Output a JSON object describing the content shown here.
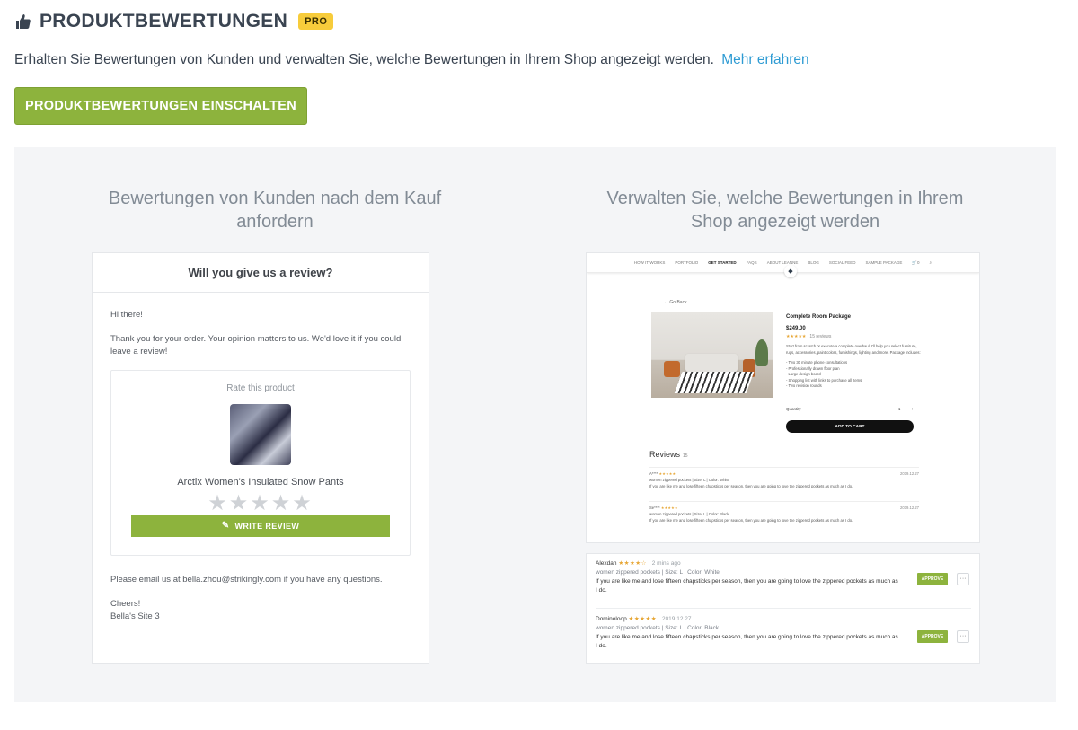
{
  "header": {
    "icon": "thumbs-up-icon",
    "title": "PRODUKTBEWERTUNGEN",
    "badge": "PRO",
    "badge_color": "#f7cc3b"
  },
  "description": {
    "text": "Erhalten Sie Bewertungen von Kunden und verwalten Sie, welche Bewertungen in Ihrem Shop angezeigt werden.",
    "link": "Mehr erfahren"
  },
  "cta": {
    "label": "PRODUKTBEWERTUNGEN EINSCHALTEN",
    "color": "#8db33d"
  },
  "feature_left": {
    "title": "Bewertungen von Kunden nach dem Kauf anfordern",
    "email": {
      "heading": "Will you give us a review?",
      "greeting": "Hi there!",
      "body": "Thank you for your order. Your opinion matters to us. We'd love it if you could leave a review!",
      "rate_label": "Rate this product",
      "product_name": "Arctix Women's Insulated Snow Pants",
      "stars": "★★★★★",
      "write_button": "WRITE REVIEW",
      "contact": "Please email us at bella.zhou@strikingly.com if you have any questions.",
      "signoff": "Cheers!",
      "signature": "Bella's Site 3"
    }
  },
  "feature_right": {
    "title": "Verwalten Sie, welche Bewertungen in Ihrem Shop angezeigt werden",
    "shop": {
      "nav": [
        "HOW IT WORKS",
        "PORTFOLIO",
        "GET STARTED",
        "FAQS",
        "ABOUT LEANNE",
        "BLOG",
        "SOCIAL FEED",
        "SAMPLE PACKAGE",
        "0"
      ],
      "active_nav": "GET STARTED",
      "go_back": "← Go Back",
      "product_title": "Complete Room Package",
      "price": "$249.00",
      "rating": "★★★★★",
      "review_count": "15 reviews",
      "desc": "Start from scratch or execute a complete overhaul. I'll help you select furniture, rugs, accessories, paint colors, furnishings, lighting and more. Package includes:",
      "bullets": [
        "- Two 30 minute phone consultations",
        "- Professionally drawn floor plan",
        "- Large design board",
        "- Shopping list with links to purchase all items",
        "- Two revision rounds"
      ],
      "quantity_label": "Quantity",
      "quantity": "1",
      "add_to_cart": "ADD TO CART",
      "reviews_heading": "Reviews",
      "reviews_count": "15",
      "reviews": [
        {
          "name": "A****",
          "stars": "★★★★★",
          "meta": "women zippered pockets  |  Size: L  |  Color: White",
          "text": "If you are like me and lose fifteen chapsticks per season, then you are going to love the zippered pockets as much as I do.",
          "date": "2019.12.27"
        },
        {
          "name": "Se****",
          "stars": "★★★★★",
          "meta": "women zippered pockets  |  Size: L  |  Color: Black",
          "text": "If you are like me and lose fifteen chapsticks per season, then you are going to love the zippered pockets as much as I do.",
          "date": "2019.12.27"
        }
      ]
    },
    "admin": {
      "rows": [
        {
          "name": "Alexdan",
          "stars": "★★★★☆",
          "time": "2 mins ago",
          "meta": "women zippered pockets  |  Size: L  |  Color: White",
          "text": "If you are like me and lose fifteen chapsticks per season, then you are going to love the zippered pockets as much as I do.",
          "approve": "APPROVE",
          "more": "···"
        },
        {
          "name": "Dominoloop",
          "stars": "★★★★★",
          "time": "2019.12.27",
          "meta": "women zippered pockets  |  Size: L  |  Color: Black",
          "text": "If you are like me and lose fifteen chapsticks per season, then you are going to love the zippered pockets as much as I do.",
          "approve": "APPROVE",
          "more": "···"
        }
      ]
    }
  }
}
